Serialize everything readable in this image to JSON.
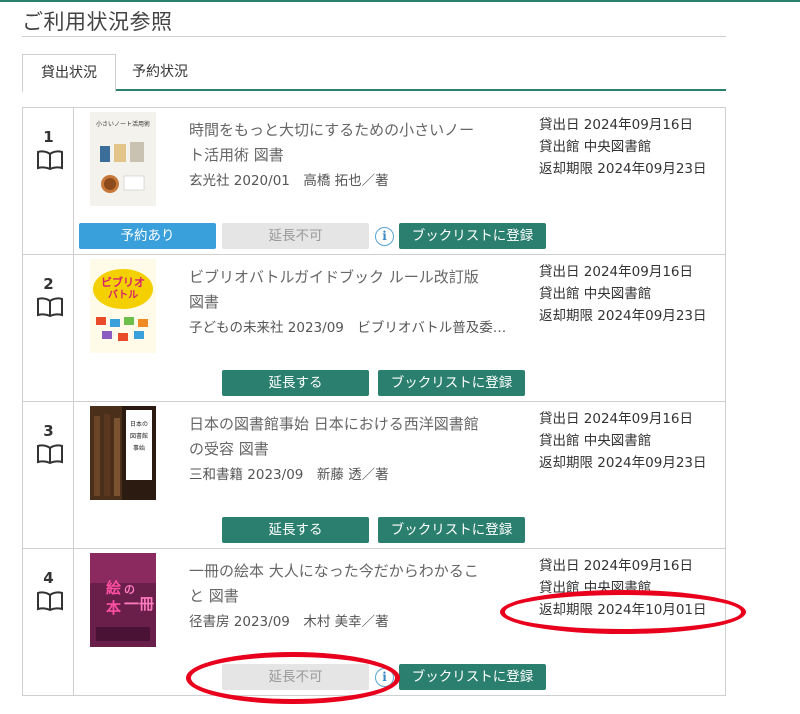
{
  "page": {
    "title": "ご利用状況参照"
  },
  "tabs": [
    {
      "label": "貸出状況",
      "active": true
    },
    {
      "label": "予約状況",
      "active": false
    }
  ],
  "icons": {
    "book": "open-book-icon",
    "info": "info-icon"
  },
  "colors": {
    "accent": "#2b7f6e",
    "reserved": "#3aa0dc",
    "disabled": "#e5e5e5",
    "highlight": "#e8001c"
  },
  "loans": [
    {
      "number": "1",
      "title": "時間をもっと大切にするための小さいノート活用術 図書",
      "publisher_line": "玄光社 2020/01　高橋 拓也／著",
      "loan_date": "貸出日 2024年09月16日",
      "library": "貸出館 中央図書館",
      "due_date": "返却期限 2024年09月23日",
      "reserved_label": "予約あり",
      "extend_label": "延長不可",
      "booklist_label": "ブックリストに登録",
      "cover_text": "小さいノート活用術"
    },
    {
      "number": "2",
      "title": "ビブリオバトルガイドブック ルール改訂版 図書",
      "publisher_line": "子どもの未来社 2023/09　ビブリオバトル普及委…",
      "loan_date": "貸出日 2024年09月16日",
      "library": "貸出館 中央図書館",
      "due_date": "返却期限 2024年09月23日",
      "extend_label": "延長する",
      "booklist_label": "ブックリストに登録",
      "cover_text": "ビブリオバトル"
    },
    {
      "number": "3",
      "title": "日本の図書館事始 日本における西洋図書館の受容 図書",
      "publisher_line": "三和書籍 2023/09　新藤 透／著",
      "loan_date": "貸出日 2024年09月16日",
      "library": "貸出館 中央図書館",
      "due_date": "返却期限 2024年09月23日",
      "extend_label": "延長する",
      "booklist_label": "ブックリストに登録",
      "cover_text": "日本の図書館事始"
    },
    {
      "number": "4",
      "title": "一冊の絵本 大人になった今だからわかること 図書",
      "publisher_line": "径書房 2023/09　木村 美幸／著",
      "loan_date": "貸出日 2024年09月16日",
      "library": "貸出館 中央図書館",
      "due_date": "返却期限 2024年10月01日",
      "extend_label": "延長不可",
      "booklist_label": "ブックリストに登録",
      "cover_text": "絵本の一冊"
    }
  ]
}
